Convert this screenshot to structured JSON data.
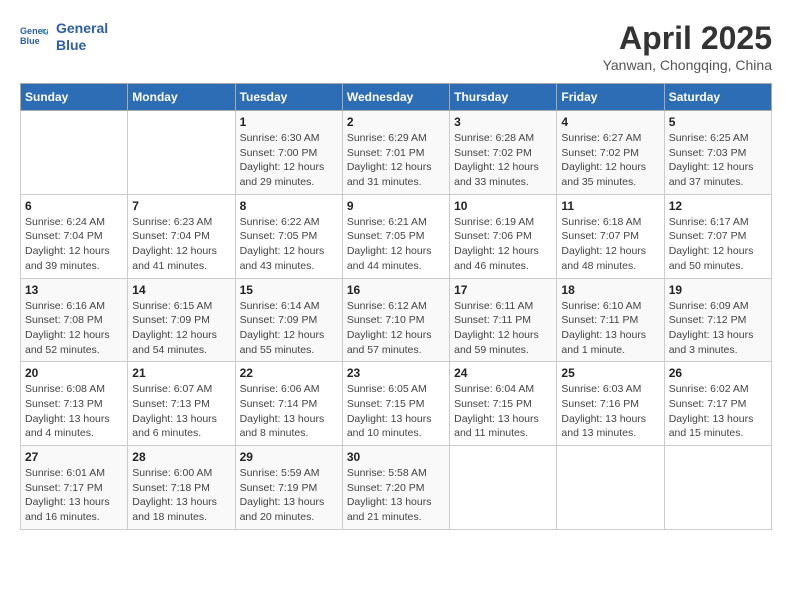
{
  "header": {
    "logo_line1": "General",
    "logo_line2": "Blue",
    "month_title": "April 2025",
    "subtitle": "Yanwan, Chongqing, China"
  },
  "calendar": {
    "days_of_week": [
      "Sunday",
      "Monday",
      "Tuesday",
      "Wednesday",
      "Thursday",
      "Friday",
      "Saturday"
    ],
    "weeks": [
      [
        {
          "day": "",
          "details": ""
        },
        {
          "day": "",
          "details": ""
        },
        {
          "day": "1",
          "details": "Sunrise: 6:30 AM\nSunset: 7:00 PM\nDaylight: 12 hours\nand 29 minutes."
        },
        {
          "day": "2",
          "details": "Sunrise: 6:29 AM\nSunset: 7:01 PM\nDaylight: 12 hours\nand 31 minutes."
        },
        {
          "day": "3",
          "details": "Sunrise: 6:28 AM\nSunset: 7:02 PM\nDaylight: 12 hours\nand 33 minutes."
        },
        {
          "day": "4",
          "details": "Sunrise: 6:27 AM\nSunset: 7:02 PM\nDaylight: 12 hours\nand 35 minutes."
        },
        {
          "day": "5",
          "details": "Sunrise: 6:25 AM\nSunset: 7:03 PM\nDaylight: 12 hours\nand 37 minutes."
        }
      ],
      [
        {
          "day": "6",
          "details": "Sunrise: 6:24 AM\nSunset: 7:04 PM\nDaylight: 12 hours\nand 39 minutes."
        },
        {
          "day": "7",
          "details": "Sunrise: 6:23 AM\nSunset: 7:04 PM\nDaylight: 12 hours\nand 41 minutes."
        },
        {
          "day": "8",
          "details": "Sunrise: 6:22 AM\nSunset: 7:05 PM\nDaylight: 12 hours\nand 43 minutes."
        },
        {
          "day": "9",
          "details": "Sunrise: 6:21 AM\nSunset: 7:05 PM\nDaylight: 12 hours\nand 44 minutes."
        },
        {
          "day": "10",
          "details": "Sunrise: 6:19 AM\nSunset: 7:06 PM\nDaylight: 12 hours\nand 46 minutes."
        },
        {
          "day": "11",
          "details": "Sunrise: 6:18 AM\nSunset: 7:07 PM\nDaylight: 12 hours\nand 48 minutes."
        },
        {
          "day": "12",
          "details": "Sunrise: 6:17 AM\nSunset: 7:07 PM\nDaylight: 12 hours\nand 50 minutes."
        }
      ],
      [
        {
          "day": "13",
          "details": "Sunrise: 6:16 AM\nSunset: 7:08 PM\nDaylight: 12 hours\nand 52 minutes."
        },
        {
          "day": "14",
          "details": "Sunrise: 6:15 AM\nSunset: 7:09 PM\nDaylight: 12 hours\nand 54 minutes."
        },
        {
          "day": "15",
          "details": "Sunrise: 6:14 AM\nSunset: 7:09 PM\nDaylight: 12 hours\nand 55 minutes."
        },
        {
          "day": "16",
          "details": "Sunrise: 6:12 AM\nSunset: 7:10 PM\nDaylight: 12 hours\nand 57 minutes."
        },
        {
          "day": "17",
          "details": "Sunrise: 6:11 AM\nSunset: 7:11 PM\nDaylight: 12 hours\nand 59 minutes."
        },
        {
          "day": "18",
          "details": "Sunrise: 6:10 AM\nSunset: 7:11 PM\nDaylight: 13 hours\nand 1 minute."
        },
        {
          "day": "19",
          "details": "Sunrise: 6:09 AM\nSunset: 7:12 PM\nDaylight: 13 hours\nand 3 minutes."
        }
      ],
      [
        {
          "day": "20",
          "details": "Sunrise: 6:08 AM\nSunset: 7:13 PM\nDaylight: 13 hours\nand 4 minutes."
        },
        {
          "day": "21",
          "details": "Sunrise: 6:07 AM\nSunset: 7:13 PM\nDaylight: 13 hours\nand 6 minutes."
        },
        {
          "day": "22",
          "details": "Sunrise: 6:06 AM\nSunset: 7:14 PM\nDaylight: 13 hours\nand 8 minutes."
        },
        {
          "day": "23",
          "details": "Sunrise: 6:05 AM\nSunset: 7:15 PM\nDaylight: 13 hours\nand 10 minutes."
        },
        {
          "day": "24",
          "details": "Sunrise: 6:04 AM\nSunset: 7:15 PM\nDaylight: 13 hours\nand 11 minutes."
        },
        {
          "day": "25",
          "details": "Sunrise: 6:03 AM\nSunset: 7:16 PM\nDaylight: 13 hours\nand 13 minutes."
        },
        {
          "day": "26",
          "details": "Sunrise: 6:02 AM\nSunset: 7:17 PM\nDaylight: 13 hours\nand 15 minutes."
        }
      ],
      [
        {
          "day": "27",
          "details": "Sunrise: 6:01 AM\nSunset: 7:17 PM\nDaylight: 13 hours\nand 16 minutes."
        },
        {
          "day": "28",
          "details": "Sunrise: 6:00 AM\nSunset: 7:18 PM\nDaylight: 13 hours\nand 18 minutes."
        },
        {
          "day": "29",
          "details": "Sunrise: 5:59 AM\nSunset: 7:19 PM\nDaylight: 13 hours\nand 20 minutes."
        },
        {
          "day": "30",
          "details": "Sunrise: 5:58 AM\nSunset: 7:20 PM\nDaylight: 13 hours\nand 21 minutes."
        },
        {
          "day": "",
          "details": ""
        },
        {
          "day": "",
          "details": ""
        },
        {
          "day": "",
          "details": ""
        }
      ]
    ]
  }
}
